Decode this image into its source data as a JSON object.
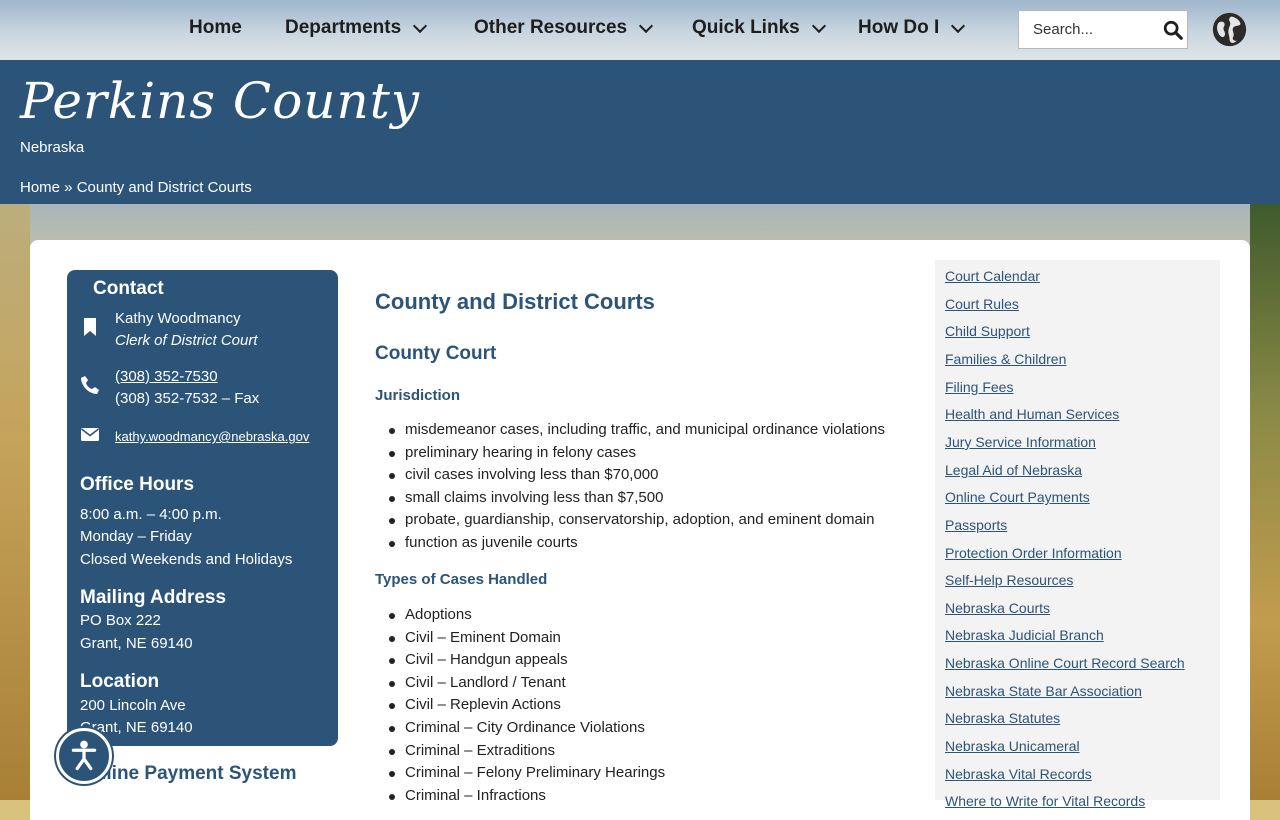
{
  "nav": {
    "items": [
      {
        "label": "Home",
        "dropdown": false
      },
      {
        "label": "Departments",
        "dropdown": true
      },
      {
        "label": "Other Resources",
        "dropdown": true
      },
      {
        "label": "Quick Links",
        "dropdown": true
      },
      {
        "label": "How Do I",
        "dropdown": true
      }
    ],
    "search_placeholder": "Search..."
  },
  "header": {
    "logo_title": "Perkins County",
    "logo_subtitle": "Nebraska",
    "breadcrumb": "Home » County and District Courts"
  },
  "contact": {
    "title": "Contact",
    "name": "Kathy Woodmancy",
    "role": "Clerk of District Court",
    "phone": "(308) 352-7530",
    "fax": "(308) 352-7532 – Fax",
    "email": "kathy.woodmancy@nebraska.gov",
    "hours_title": "Office Hours",
    "hours": [
      "8:00 a.m. – 4:00 p.m.",
      "Monday – Friday",
      "Closed Weekends and Holidays"
    ],
    "mailing_title": "Mailing Address",
    "mailing": [
      "PO Box 222",
      "Grant, NE 69140"
    ],
    "location_title": "Location",
    "location": [
      "200 Lincoln Ave",
      "Grant, NE 69140"
    ]
  },
  "online_payment_heading": "Online Payment System",
  "main": {
    "page_title": "County and District Courts",
    "section_title": "County Court",
    "jurisdiction_title": "Jurisdiction",
    "jurisdiction": [
      "misdemeanor cases, including traffic, and municipal ordinance violations",
      "preliminary hearing in felony cases",
      "civil cases involving less than $70,000",
      "small claims involving less than $7,500",
      "probate, guardianship, conservatorship, adoption, and eminent domain",
      "function as juvenile courts"
    ],
    "types_title": "Types of Cases Handled",
    "types": [
      "Adoptions",
      "Civil – Eminent Domain",
      "Civil – Handgun appeals",
      "Civil – Landlord / Tenant",
      "Civil – Replevin Actions",
      "Criminal – City Ordinance Violations",
      "Criminal – Extraditions",
      "Criminal – Felony Preliminary Hearings",
      "Criminal – Infractions"
    ]
  },
  "sidebar_links": [
    "Court Calendar",
    "Court Rules",
    "Child Support",
    "Families & Children",
    "Filing Fees",
    "Health and Human Services",
    "Jury Service Information",
    "Legal Aid of Nebraska",
    "Online Court Payments",
    "Passports",
    "Protection Order Information",
    "Self-Help Resources",
    "Nebraska Courts",
    "Nebraska Judicial Branch",
    "Nebraska Online Court Record Search",
    "Nebraska State Bar Association",
    "Nebraska Statutes",
    "Nebraska Unicameral",
    "Nebraska Vital Records",
    "Where to Write for Vital Records"
  ],
  "colors": {
    "brand_blue": "#2c5479",
    "link_blue": "#2c5479",
    "sidebar_bg": "#f3f3f3"
  }
}
